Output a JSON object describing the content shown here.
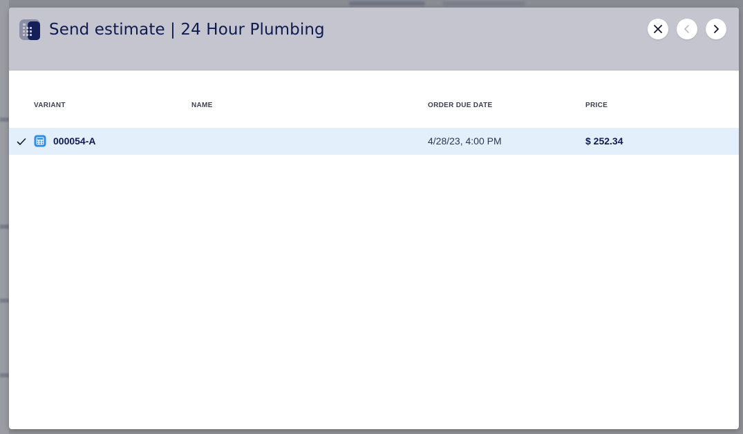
{
  "header": {
    "title": "Send estimate | 24 Hour Plumbing",
    "logo_icon": "estimate-calculator-icon",
    "buttons": {
      "close_icon": "close-icon",
      "prev_icon": "chevron-left-icon",
      "next_icon": "chevron-right-icon"
    }
  },
  "table": {
    "columns": {
      "variant": "VARIANT",
      "name": "NAME",
      "order_due_date": "ORDER DUE DATE",
      "price": "PRICE"
    },
    "rows": [
      {
        "selected": true,
        "icon": "calculator-icon",
        "variant": "000054-A",
        "name": "",
        "order_due_date": "4/28/23, 4:00 PM",
        "price": "$ 252.34"
      }
    ]
  },
  "colors": {
    "header_bg": "#c4c5ce",
    "title": "#0f1a4f",
    "row_selected_bg": "#e3f0fc",
    "icon_blue": "#2f8de4"
  }
}
